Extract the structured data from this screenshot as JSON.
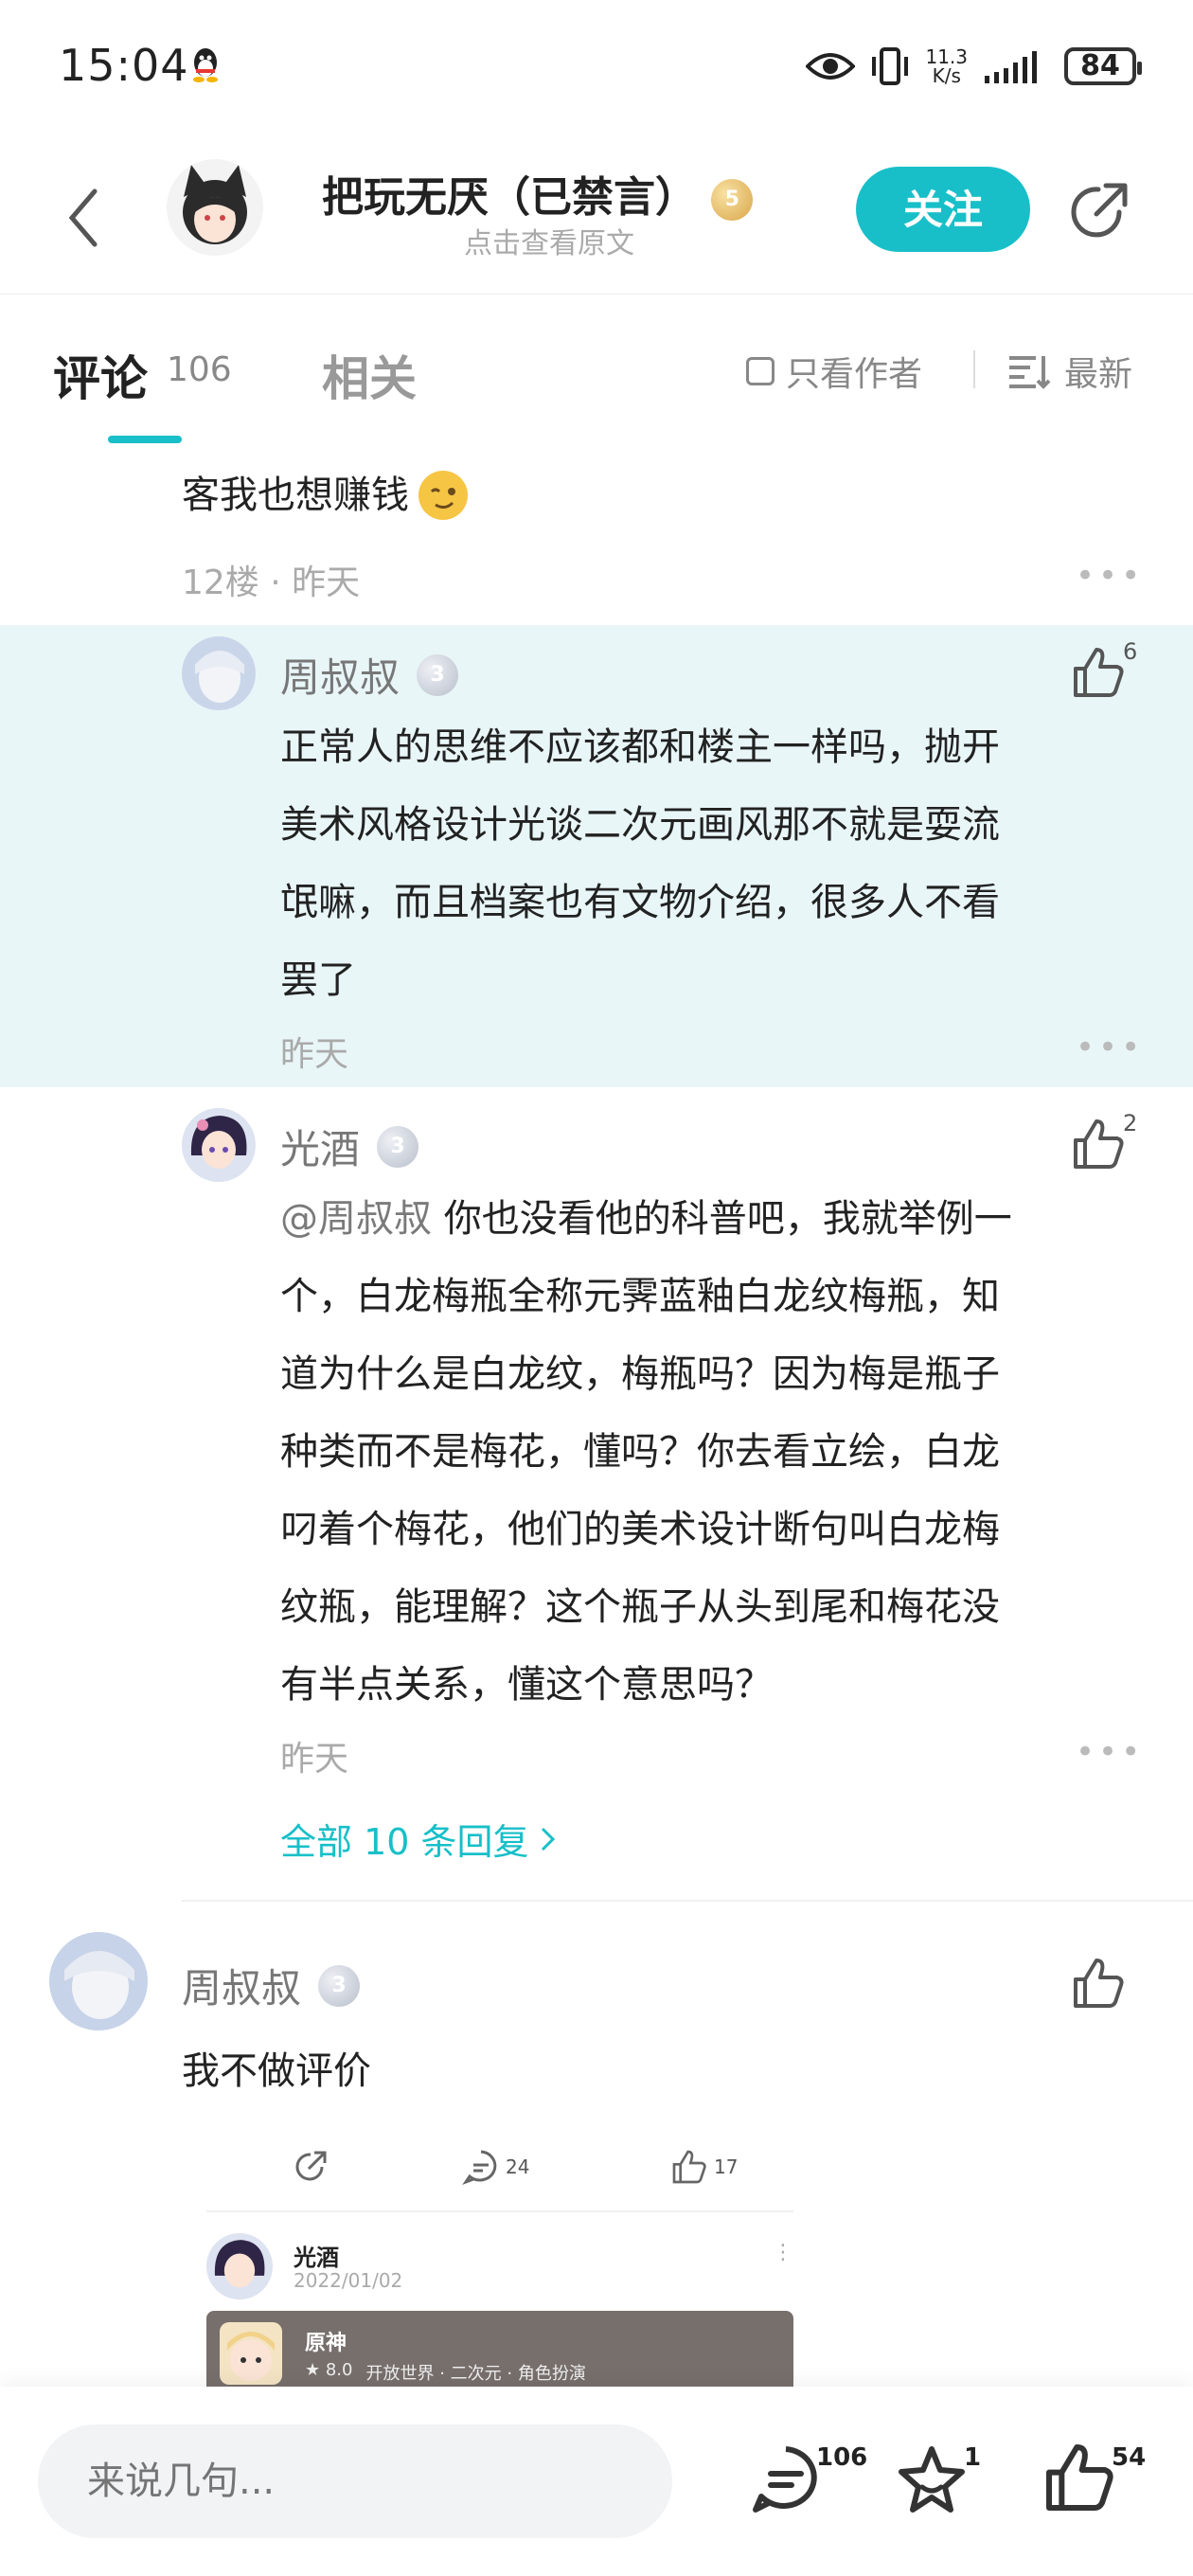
{
  "status_bar": {
    "time": "15:04",
    "net_speed_top": "11.3",
    "net_speed_bottom": "K/s",
    "battery": "84"
  },
  "header": {
    "title": "把玩无厌（已禁言）",
    "level": "5",
    "subtitle": "点击查看原文",
    "follow_label": "关注"
  },
  "tabs": {
    "comments_label": "评论",
    "comments_count": "106",
    "related_label": "相关",
    "only_author_label": "只看作者",
    "sort_label": "最新"
  },
  "comments": [
    {
      "text": "客我也想赚钱",
      "floor": "12楼 · 昨天"
    },
    {
      "name": "周叔叔",
      "level": "3",
      "likes": "6",
      "text": [
        "正常人的思维不应该都和楼主一样吗，抛开",
        "美术风格设计光谈二次元画风那不就是耍流",
        "氓嘛，而且档案也有文物介绍，很多人不看",
        "罢了"
      ],
      "time": "昨天"
    },
    {
      "name": "光酒",
      "level": "3",
      "likes": "2",
      "mention": "@周叔叔",
      "text": [
        "你也没看他的科普吧，我就举例一",
        "个，白龙梅瓶全称元霁蓝釉白龙纹梅瓶，知",
        "道为什么是白龙纹，梅瓶吗？因为梅是瓶子",
        "种类而不是梅花，懂吗？你去看立绘，白龙",
        "叼着个梅花，他们的美术设计断句叫白龙梅",
        "纹瓶，能理解？这个瓶子从头到尾和梅花没",
        "有半点关系，懂这个意思吗？"
      ],
      "time": "昨天"
    },
    {
      "all_replies": "全部 10 条回复"
    },
    {
      "name": "周叔叔",
      "level": "3",
      "text": "我不做评价"
    }
  ],
  "embed": {
    "reply_count": "24",
    "like_count": "17",
    "user": "光酒",
    "date": "2022/01/02",
    "game_name": "原神",
    "game_rating": "★ 8.0",
    "game_tags": "开放世界 · 二次元 · 角色扮演"
  },
  "bottom_bar": {
    "input_placeholder": "来说几句...",
    "comment_count": "106",
    "star_count": "1",
    "like_count": "54"
  },
  "colors": {
    "accent": "#18bfc8",
    "highlight_bg": "#e9f6f8"
  }
}
